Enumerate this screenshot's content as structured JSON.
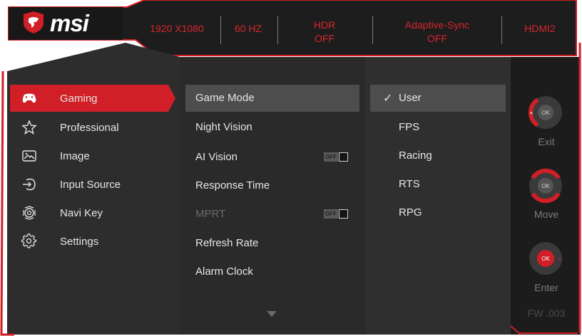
{
  "brand": {
    "logo_text": "msi",
    "logo_icon": "dragon-shield-icon"
  },
  "status_bar": {
    "resolution": "1920 X1080",
    "refresh": "60 HZ",
    "hdr_line1": "HDR",
    "hdr_line2": "OFF",
    "adaptive_line1": "Adaptive-Sync",
    "adaptive_line2": "OFF",
    "input": "HDMI2"
  },
  "main_menu": {
    "items": [
      {
        "label": "Gaming",
        "icon": "gamepad-icon",
        "active": true
      },
      {
        "label": "Professional",
        "icon": "star-icon"
      },
      {
        "label": "Image",
        "icon": "image-icon"
      },
      {
        "label": "Input Source",
        "icon": "input-source-icon"
      },
      {
        "label": "Navi Key",
        "icon": "navi-key-icon"
      },
      {
        "label": "Settings",
        "icon": "gear-icon"
      }
    ]
  },
  "submenu": {
    "items": [
      {
        "label": "Game Mode",
        "active": true
      },
      {
        "label": "Night Vision"
      },
      {
        "label": "AI Vision",
        "toggle": "OFF"
      },
      {
        "label": "Response Time"
      },
      {
        "label": "MPRT",
        "toggle": "OFF",
        "disabled": true
      },
      {
        "label": "Refresh Rate"
      },
      {
        "label": "Alarm Clock"
      }
    ],
    "scroll_icon": "chevron-down-icon"
  },
  "options": {
    "items": [
      {
        "label": "User",
        "checked": true
      },
      {
        "label": "FPS"
      },
      {
        "label": "Racing"
      },
      {
        "label": "RTS"
      },
      {
        "label": "RPG"
      }
    ],
    "check_glyph": "✓"
  },
  "nav_keys": {
    "exit": {
      "label": "Exit",
      "center": "OK"
    },
    "move": {
      "label": "Move",
      "center": "OK"
    },
    "enter": {
      "label": "Enter",
      "center": "OK"
    }
  },
  "firmware": "FW .003",
  "colors": {
    "accent": "#d01f26",
    "panel": "#2b2b2b",
    "header": "#1e1e1e",
    "highlight": "#4d4d4d",
    "text": "#e6e6e6"
  }
}
